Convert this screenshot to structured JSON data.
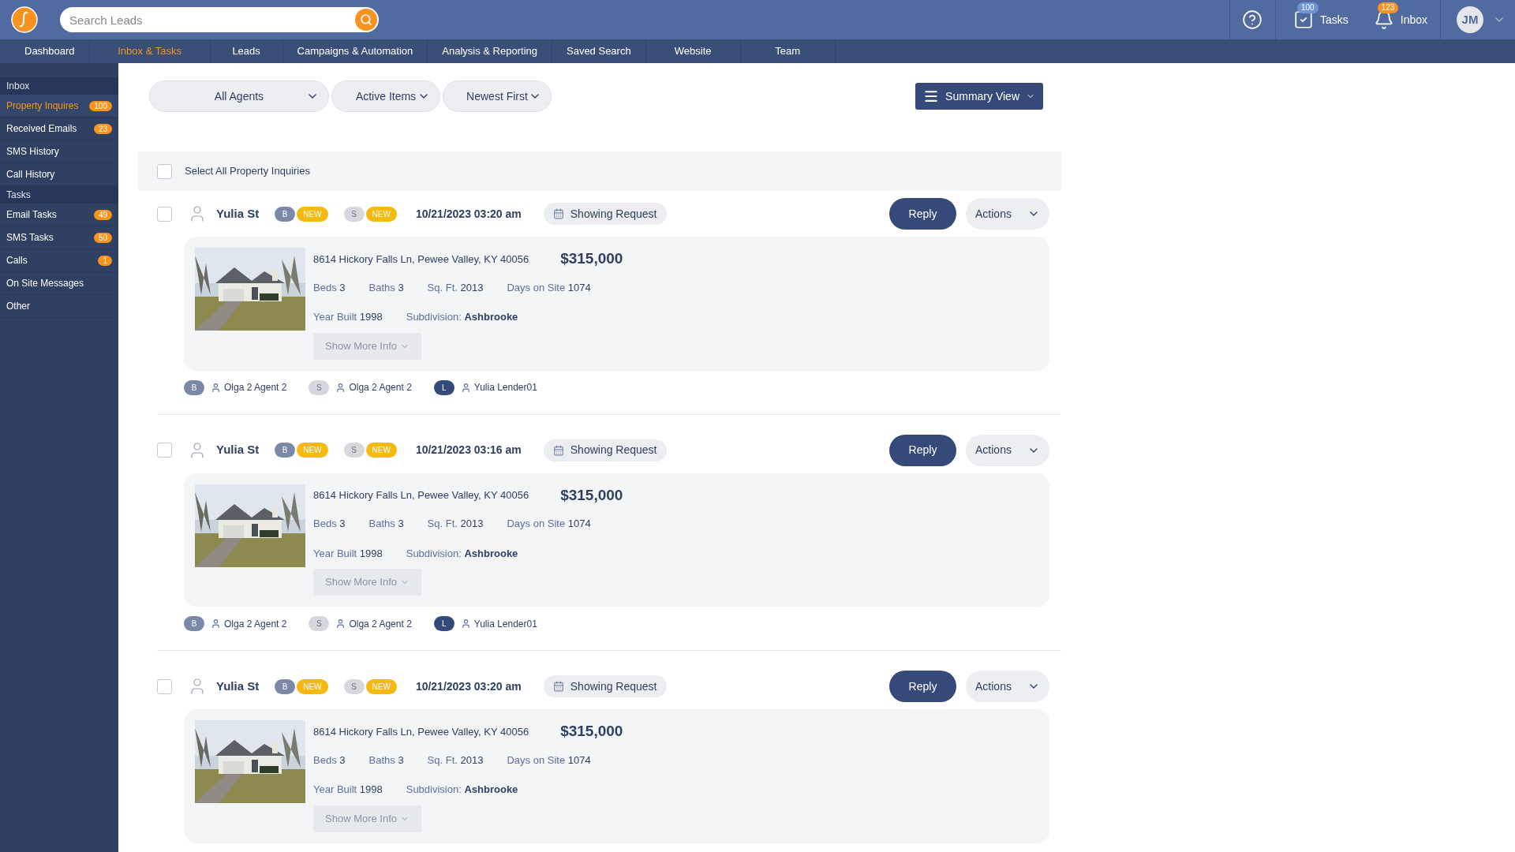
{
  "header": {
    "search_placeholder": "Search Leads",
    "tasks": {
      "label": "Tasks",
      "count": "100"
    },
    "inbox": {
      "label": "Inbox",
      "count": "123"
    },
    "avatar": "JM"
  },
  "nav": [
    {
      "label": "Dashboard",
      "selected": false
    },
    {
      "label": "Inbox & Tasks",
      "selected": true
    },
    {
      "label": "Leads",
      "selected": false
    },
    {
      "label": "Campaigns & Automation",
      "selected": false
    },
    {
      "label": "Analysis & Reporting",
      "selected": false
    },
    {
      "label": "Saved Search",
      "selected": false
    },
    {
      "label": "Website",
      "selected": false
    },
    {
      "label": "Team",
      "selected": false
    }
  ],
  "sidebar": [
    {
      "title": "Inbox",
      "items": [
        {
          "label": "Property Inquires",
          "count": "100",
          "selected": true
        },
        {
          "label": "Received Emails",
          "count": "23",
          "selected": false
        },
        {
          "label": "SMS History",
          "selected": false
        },
        {
          "label": "Call History",
          "selected": false
        }
      ]
    },
    {
      "title": "Tasks",
      "items": [
        {
          "label": "Email Tasks",
          "count": "49",
          "selected": false
        },
        {
          "label": "SMS Tasks",
          "count": "50",
          "selected": false
        },
        {
          "label": "Calls",
          "count": "1",
          "selected": false
        },
        {
          "label": "On Site Messages",
          "selected": false
        },
        {
          "label": "Other",
          "selected": false
        }
      ]
    }
  ],
  "filters": [
    {
      "label": "All Agents"
    },
    {
      "label": "Active Items"
    },
    {
      "label": "Newest First"
    }
  ],
  "view_button": "Summary View",
  "select_all": {
    "label": "Select All Property Inquiries",
    "checked": false
  },
  "inquiries": [
    {
      "checked": false,
      "name": "Yulia St",
      "tags": [
        {
          "letter": "B",
          "kind": "buyer",
          "status": "NEW"
        },
        {
          "letter": "S",
          "kind": "seller",
          "status": "NEW"
        }
      ],
      "date": "10/21/2023 03:20 am",
      "type": "Showing Request",
      "reply": "Reply",
      "actions": "Actions",
      "property": {
        "address": "8614 Hickory Falls Ln, Pewee Valley, KY 40056",
        "price": "$315,000",
        "facts": [
          {
            "label": "Beds",
            "value": "3"
          },
          {
            "label": "Baths",
            "value": "3"
          },
          {
            "label": "Sq. Ft.",
            "value": "2013"
          },
          {
            "label": "Days on Site",
            "value": "1074"
          }
        ],
        "year_built": {
          "label": "Year Built",
          "value": "1998"
        },
        "subdivision": {
          "label": "Subdivision:",
          "value": "Ashbrooke"
        },
        "more": "Show More Info"
      },
      "agents": [
        {
          "letter": "B",
          "kind": "buyer",
          "name": "Olga 2 Agent 2"
        },
        {
          "letter": "S",
          "kind": "seller",
          "name": "Olga 2 Agent 2"
        },
        {
          "letter": "L",
          "kind": "lender",
          "name": "Yulia Lender01"
        }
      ]
    },
    {
      "checked": false,
      "name": "Yulia St",
      "tags": [
        {
          "letter": "B",
          "kind": "buyer",
          "status": "NEW"
        },
        {
          "letter": "S",
          "kind": "seller",
          "status": "NEW"
        }
      ],
      "date": "10/21/2023 03:16 am",
      "type": "Showing Request",
      "reply": "Reply",
      "actions": "Actions",
      "property": {
        "address": "8614 Hickory Falls Ln, Pewee Valley, KY 40056",
        "price": "$315,000",
        "facts": [
          {
            "label": "Beds",
            "value": "3"
          },
          {
            "label": "Baths",
            "value": "3"
          },
          {
            "label": "Sq. Ft.",
            "value": "2013"
          },
          {
            "label": "Days on Site",
            "value": "1074"
          }
        ],
        "year_built": {
          "label": "Year Built",
          "value": "1998"
        },
        "subdivision": {
          "label": "Subdivision:",
          "value": "Ashbrooke"
        },
        "more": "Show More Info"
      },
      "agents": [
        {
          "letter": "B",
          "kind": "buyer",
          "name": "Olga 2 Agent 2"
        },
        {
          "letter": "S",
          "kind": "seller",
          "name": "Olga 2 Agent 2"
        },
        {
          "letter": "L",
          "kind": "lender",
          "name": "Yulia Lender01"
        }
      ]
    },
    {
      "checked": false,
      "name": "Yulia St",
      "tags": [
        {
          "letter": "B",
          "kind": "buyer",
          "status": "NEW"
        },
        {
          "letter": "S",
          "kind": "seller",
          "status": "NEW"
        }
      ],
      "date": "10/21/2023 03:20 am",
      "type": "Showing Request",
      "reply": "Reply",
      "actions": "Actions",
      "property": {
        "address": "8614 Hickory Falls Ln, Pewee Valley, KY 40056",
        "price": "$315,000",
        "facts": [
          {
            "label": "Beds",
            "value": "3"
          },
          {
            "label": "Baths",
            "value": "3"
          },
          {
            "label": "Sq. Ft.",
            "value": "2013"
          },
          {
            "label": "Days on Site",
            "value": "1074"
          }
        ],
        "year_built": {
          "label": "Year Built",
          "value": "1998"
        },
        "subdivision": {
          "label": "Subdivision:",
          "value": "Ashbrooke"
        },
        "more": "Show More Info"
      }
    }
  ]
}
